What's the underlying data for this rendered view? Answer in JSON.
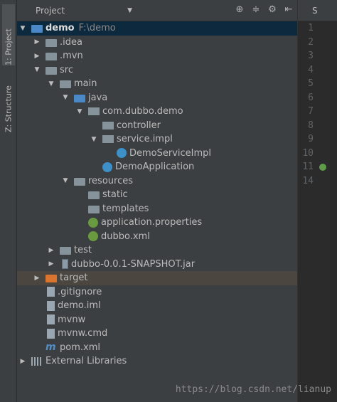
{
  "side_tabs": {
    "project": "1: Project",
    "structure": "Z: Structure"
  },
  "toolbar": {
    "title": "Project",
    "dropdown": "▼"
  },
  "tree": [
    {
      "depth": 0,
      "arrow": "▼",
      "icon": "module-folder-icon",
      "iconClass": "folder blue",
      "label": "demo",
      "path": "F:\\demo",
      "bold": true,
      "selected": true
    },
    {
      "depth": 1,
      "arrow": "▶",
      "icon": "folder-icon",
      "iconClass": "folder",
      "label": ".idea"
    },
    {
      "depth": 1,
      "arrow": "▶",
      "icon": "folder-icon",
      "iconClass": "folder",
      "label": ".mvn"
    },
    {
      "depth": 1,
      "arrow": "▼",
      "icon": "folder-icon",
      "iconClass": "folder",
      "label": "src"
    },
    {
      "depth": 2,
      "arrow": "▼",
      "icon": "folder-icon",
      "iconClass": "folder",
      "label": "main"
    },
    {
      "depth": 3,
      "arrow": "▼",
      "icon": "source-folder-icon",
      "iconClass": "folder blue",
      "label": "java"
    },
    {
      "depth": 4,
      "arrow": "▼",
      "icon": "package-icon",
      "iconClass": "pkg",
      "label": "com.dubbo.demo"
    },
    {
      "depth": 5,
      "arrow": "",
      "icon": "package-icon",
      "iconClass": "pkg",
      "label": "controller"
    },
    {
      "depth": 5,
      "arrow": "▼",
      "icon": "package-icon",
      "iconClass": "pkg",
      "label": "service.impl"
    },
    {
      "depth": 6,
      "arrow": "",
      "icon": "class-icon",
      "iconClass": "cls",
      "label": "DemoServiceImpl"
    },
    {
      "depth": 5,
      "arrow": "",
      "icon": "spring-class-icon",
      "iconClass": "cls",
      "label": "DemoApplication"
    },
    {
      "depth": 3,
      "arrow": "▼",
      "icon": "resources-folder-icon",
      "iconClass": "folder",
      "label": "resources"
    },
    {
      "depth": 4,
      "arrow": "",
      "icon": "folder-icon",
      "iconClass": "folder",
      "label": "static"
    },
    {
      "depth": 4,
      "arrow": "",
      "icon": "folder-icon",
      "iconClass": "folder",
      "label": "templates"
    },
    {
      "depth": 4,
      "arrow": "",
      "icon": "spring-properties-icon",
      "iconClass": "spring",
      "label": "application.properties"
    },
    {
      "depth": 4,
      "arrow": "",
      "icon": "xml-file-icon",
      "iconClass": "spring",
      "label": "dubbo.xml"
    },
    {
      "depth": 2,
      "arrow": "▶",
      "icon": "folder-icon",
      "iconClass": "folder",
      "label": "test"
    },
    {
      "depth": 2,
      "arrow": "▶",
      "icon": "jar-icon",
      "iconClass": "jar",
      "label": "dubbo-0.0.1-SNAPSHOT.jar"
    },
    {
      "depth": 1,
      "arrow": "▶",
      "icon": "excluded-folder-icon",
      "iconClass": "folder orange",
      "label": "target",
      "highlight": true
    },
    {
      "depth": 1,
      "arrow": "",
      "icon": "file-icon",
      "iconClass": "file",
      "label": ".gitignore"
    },
    {
      "depth": 1,
      "arrow": "",
      "icon": "file-icon",
      "iconClass": "file",
      "label": "demo.iml"
    },
    {
      "depth": 1,
      "arrow": "",
      "icon": "file-icon",
      "iconClass": "file",
      "label": "mvnw"
    },
    {
      "depth": 1,
      "arrow": "",
      "icon": "file-icon",
      "iconClass": "file",
      "label": "mvnw.cmd"
    },
    {
      "depth": 1,
      "arrow": "",
      "icon": "maven-icon",
      "iconClass": "mvn",
      "label": "pom.xml",
      "glyph": "m"
    },
    {
      "depth": 0,
      "arrow": "▶",
      "icon": "libraries-icon",
      "iconClass": "libs",
      "label": "External Libraries"
    }
  ],
  "editor": {
    "tab_label": "S",
    "line_numbers": [
      "1",
      "2",
      "3",
      "4",
      "5",
      "6",
      "7",
      "8",
      "9",
      "10",
      "11",
      "14"
    ]
  },
  "watermark": "https://blog.csdn.net/lianup"
}
